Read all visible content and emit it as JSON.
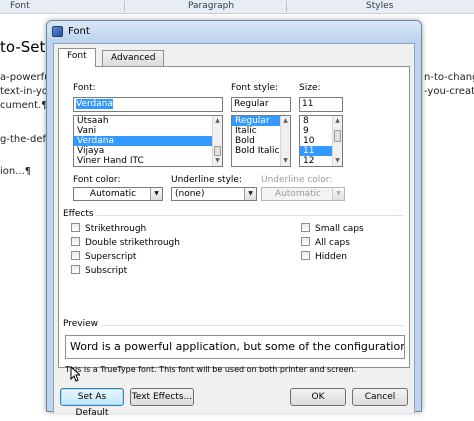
{
  "ribbon": {
    "font_label": "Font",
    "paragraph_label": "Paragraph",
    "styles_label": "Styles"
  },
  "document": {
    "title": "to-Set-",
    "lines_left": [
      "a-powerful",
      "text-in-you",
      "cument.¶",
      "g-the-defa",
      "ion...¶"
    ],
    "lines_right": [
      "n-to-change-",
      "-you-create"
    ]
  },
  "dialog": {
    "title": "Font",
    "tabs": {
      "font": "Font",
      "advanced": "Advanced"
    },
    "font": {
      "label": "Font:",
      "value": "Verdana",
      "items": [
        "Utsaah",
        "Vani",
        "Verdana",
        "Vijaya",
        "Viner Hand ITC"
      ],
      "selected": "Verdana"
    },
    "font_style": {
      "label": "Font style:",
      "value": "Regular",
      "items": [
        "Regular",
        "Italic",
        "Bold",
        "Bold Italic"
      ],
      "selected": "Regular"
    },
    "size": {
      "label": "Size:",
      "value": "11",
      "items": [
        "8",
        "9",
        "10",
        "11",
        "12"
      ],
      "selected": "11"
    },
    "font_color": {
      "label": "Font color:",
      "value": "Automatic"
    },
    "underline_style": {
      "label": "Underline style:",
      "value": "(none)"
    },
    "underline_color": {
      "label": "Underline color:",
      "value": "Automatic"
    },
    "effects": {
      "label": "Effects",
      "left": [
        "Strikethrough",
        "Double strikethrough",
        "Superscript",
        "Subscript"
      ],
      "right": [
        "Small caps",
        "All caps",
        "Hidden"
      ]
    },
    "preview": {
      "label": "Preview",
      "sample": "Word is a powerful application, but some of the configuration",
      "note": "This is a TrueType font. This font will be used on both printer and screen."
    },
    "buttons": {
      "set_default": "Set As Default",
      "text_effects": "Text Effects...",
      "ok": "OK",
      "cancel": "Cancel"
    }
  },
  "colors": {
    "selection": "#3399ff",
    "dialog_frame": "#bfd4ec",
    "focused_button": "#bee6fd"
  }
}
